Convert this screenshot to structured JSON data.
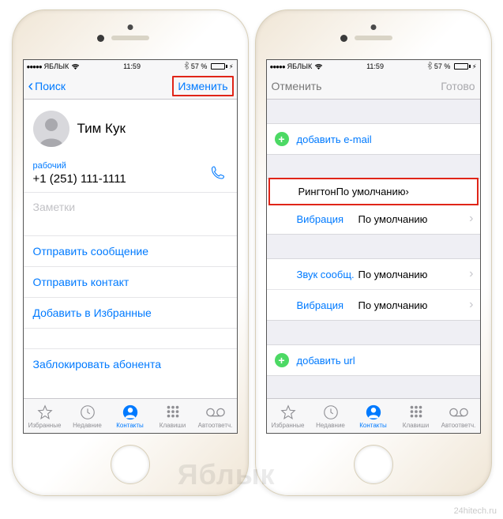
{
  "status": {
    "carrier": "ЯБЛЫК",
    "time": "11:59",
    "battery_pct": "57 %"
  },
  "left": {
    "nav_back": "Поиск",
    "nav_edit": "Изменить",
    "contact_name": "Тим Кук",
    "phone_label": "рабочий",
    "phone_number": "+1 (251) 111-1111",
    "notes_placeholder": "Заметки",
    "actions": {
      "send_message": "Отправить сообщение",
      "share_contact": "Отправить контакт",
      "add_favorite": "Добавить в Избранные",
      "block": "Заблокировать абонента"
    }
  },
  "right": {
    "nav_cancel": "Отменить",
    "nav_done": "Готово",
    "add_email": "добавить e-mail",
    "ringtone_label": "Рингтон",
    "ringtone_value": "По умолчанию",
    "vibration_label": "Вибрация",
    "vibration_value": "По умолчанию",
    "msg_sound_label": "Звук сообщ.",
    "msg_sound_value": "По умолчанию",
    "msg_vibration_label": "Вибрация",
    "msg_vibration_value": "По умолчанию",
    "add_url": "добавить url"
  },
  "tabs": {
    "favorites": "Избранные",
    "recents": "Недавние",
    "contacts": "Контакты",
    "keypad": "Клавиши",
    "voicemail": "Автоответч."
  },
  "watermark": "Яблык",
  "source": "24hitech.ru"
}
